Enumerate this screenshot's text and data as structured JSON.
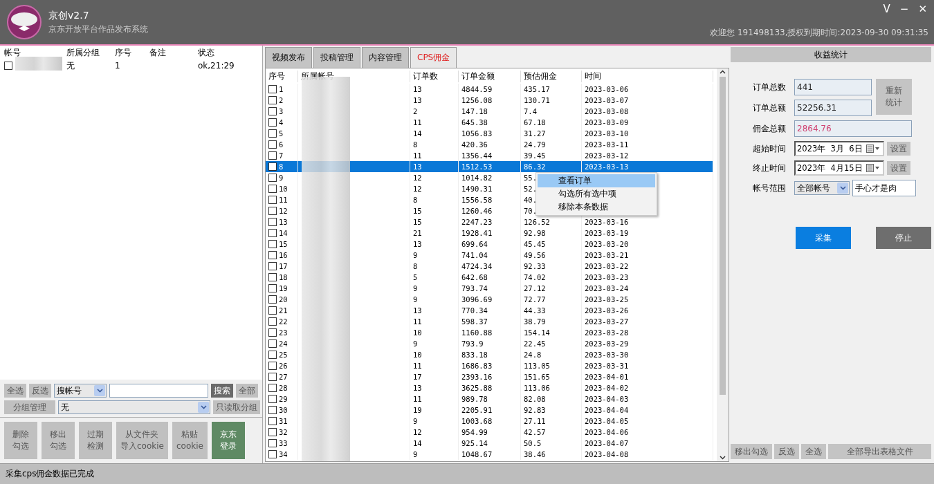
{
  "window": {
    "title": "京创v2.7",
    "subtitle": "京东开放平台作品发布系统",
    "controls": [
      "V",
      "−",
      "✕"
    ],
    "welcome": "欢迎您 191498133,授权到期时间:2023-09-30 09:31:35"
  },
  "accounts": {
    "columns": [
      "帐号",
      "所属分组",
      "序号",
      "备注",
      "状态"
    ],
    "rows": [
      {
        "checked": false,
        "group": "无",
        "index": "1",
        "status": "ok,21:29"
      }
    ]
  },
  "account_tools": {
    "select_all": "全选",
    "invert": "反选",
    "search_mode": "搜帐号",
    "search_button": "搜索",
    "all_button": "全部",
    "group_manage": "分组管理",
    "group_value": "无",
    "readonly_group": "只读取分组",
    "actions": [
      {
        "lines": [
          "删除",
          "勾选"
        ],
        "kind": "plain"
      },
      {
        "lines": [
          "移出",
          "勾选"
        ],
        "kind": "plain"
      },
      {
        "lines": [
          "过期",
          "检测"
        ],
        "kind": "plain"
      },
      {
        "lines": [
          "从文件夹",
          "导入cookie"
        ],
        "kind": "plain"
      },
      {
        "lines": [
          "粘贴",
          "cookie"
        ],
        "kind": "plain"
      },
      {
        "lines": [
          "京东",
          "登录"
        ],
        "kind": "primary"
      }
    ]
  },
  "tabs": [
    {
      "label": "视频发布",
      "selected": false
    },
    {
      "label": "投稿管理",
      "selected": false
    },
    {
      "label": "内容管理",
      "selected": false
    },
    {
      "label": "CPS佣金",
      "selected": true
    }
  ],
  "orders": {
    "columns": [
      "序号",
      "所属帐号",
      "订单数",
      "订单金额",
      "预估佣金",
      "时间"
    ],
    "rows": [
      {
        "no": "1",
        "checked": false,
        "selected": false,
        "count": "13",
        "amount": "4844.59",
        "commission": "435.17",
        "time": "2023-03-06"
      },
      {
        "no": "2",
        "checked": false,
        "selected": false,
        "count": "13",
        "amount": "1256.08",
        "commission": "130.71",
        "time": "2023-03-07"
      },
      {
        "no": "3",
        "checked": false,
        "selected": false,
        "count": "2",
        "amount": "147.18",
        "commission": "7.4",
        "time": "2023-03-08"
      },
      {
        "no": "4",
        "checked": false,
        "selected": false,
        "count": "11",
        "amount": "645.38",
        "commission": "67.18",
        "time": "2023-03-09"
      },
      {
        "no": "5",
        "checked": false,
        "selected": false,
        "count": "14",
        "amount": "1056.83",
        "commission": "31.27",
        "time": "2023-03-10"
      },
      {
        "no": "6",
        "checked": false,
        "selected": false,
        "count": "8",
        "amount": "420.36",
        "commission": "24.79",
        "time": "2023-03-11"
      },
      {
        "no": "7",
        "checked": false,
        "selected": false,
        "count": "11",
        "amount": "1356.44",
        "commission": "39.45",
        "time": "2023-03-12"
      },
      {
        "no": "8",
        "checked": false,
        "selected": true,
        "count": "13",
        "amount": "1512.53",
        "commission": "86.32",
        "time": "2023-03-13"
      },
      {
        "no": "9",
        "checked": false,
        "selected": false,
        "count": "12",
        "amount": "1014.82",
        "commission": "55."
      },
      {
        "no": "10",
        "checked": false,
        "selected": false,
        "count": "12",
        "amount": "1490.31",
        "commission": "52."
      },
      {
        "no": "11",
        "checked": false,
        "selected": false,
        "count": "8",
        "amount": "1556.58",
        "commission": "40."
      },
      {
        "no": "12",
        "checked": false,
        "selected": false,
        "count": "15",
        "amount": "1260.46",
        "commission": "70."
      },
      {
        "no": "13",
        "checked": false,
        "selected": false,
        "count": "15",
        "amount": "2247.23",
        "commission": "126.52",
        "time": "2023-03-16"
      },
      {
        "no": "14",
        "checked": false,
        "selected": false,
        "count": "21",
        "amount": "1928.41",
        "commission": "92.98",
        "time": "2023-03-19"
      },
      {
        "no": "15",
        "checked": false,
        "selected": false,
        "count": "13",
        "amount": "699.64",
        "commission": "45.45",
        "time": "2023-03-20"
      },
      {
        "no": "16",
        "checked": false,
        "selected": false,
        "count": "9",
        "amount": "741.04",
        "commission": "49.56",
        "time": "2023-03-21"
      },
      {
        "no": "17",
        "checked": false,
        "selected": false,
        "count": "8",
        "amount": "4724.34",
        "commission": "92.33",
        "time": "2023-03-22"
      },
      {
        "no": "18",
        "checked": false,
        "selected": false,
        "count": "5",
        "amount": "642.68",
        "commission": "74.02",
        "time": "2023-03-23"
      },
      {
        "no": "19",
        "checked": false,
        "selected": false,
        "count": "9",
        "amount": "793.74",
        "commission": "27.12",
        "time": "2023-03-24"
      },
      {
        "no": "20",
        "checked": false,
        "selected": false,
        "count": "9",
        "amount": "3096.69",
        "commission": "72.77",
        "time": "2023-03-25"
      },
      {
        "no": "21",
        "checked": false,
        "selected": false,
        "count": "13",
        "amount": "770.34",
        "commission": "44.33",
        "time": "2023-03-26"
      },
      {
        "no": "22",
        "checked": false,
        "selected": false,
        "count": "11",
        "amount": "598.37",
        "commission": "38.79",
        "time": "2023-03-27"
      },
      {
        "no": "23",
        "checked": false,
        "selected": false,
        "count": "10",
        "amount": "1160.88",
        "commission": "154.14",
        "time": "2023-03-28"
      },
      {
        "no": "24",
        "checked": false,
        "selected": false,
        "count": "9",
        "amount": "793.9",
        "commission": "22.45",
        "time": "2023-03-29"
      },
      {
        "no": "25",
        "checked": false,
        "selected": false,
        "count": "10",
        "amount": "833.18",
        "commission": "24.8",
        "time": "2023-03-30"
      },
      {
        "no": "26",
        "checked": false,
        "selected": false,
        "count": "11",
        "amount": "1686.83",
        "commission": "113.05",
        "time": "2023-03-31"
      },
      {
        "no": "27",
        "checked": false,
        "selected": false,
        "count": "17",
        "amount": "2393.16",
        "commission": "151.65",
        "time": "2023-04-01"
      },
      {
        "no": "28",
        "checked": false,
        "selected": false,
        "count": "13",
        "amount": "3625.88",
        "commission": "113.06",
        "time": "2023-04-02"
      },
      {
        "no": "29",
        "checked": false,
        "selected": false,
        "count": "11",
        "amount": "989.78",
        "commission": "82.08",
        "time": "2023-04-03"
      },
      {
        "no": "30",
        "checked": false,
        "selected": false,
        "count": "19",
        "amount": "2205.91",
        "commission": "92.83",
        "time": "2023-04-04"
      },
      {
        "no": "31",
        "checked": false,
        "selected": false,
        "count": "9",
        "amount": "1003.68",
        "commission": "27.11",
        "time": "2023-04-05"
      },
      {
        "no": "32",
        "checked": false,
        "selected": false,
        "count": "12",
        "amount": "954.99",
        "commission": "42.57",
        "time": "2023-04-06"
      },
      {
        "no": "33",
        "checked": false,
        "selected": false,
        "count": "14",
        "amount": "925.14",
        "commission": "50.5",
        "time": "2023-04-07"
      },
      {
        "no": "34",
        "checked": false,
        "selected": false,
        "count": "9",
        "amount": "1048.67",
        "commission": "38.46",
        "time": "2023-04-08"
      }
    ]
  },
  "context_menu": {
    "items": [
      {
        "label": "查看订单",
        "selected": true
      },
      {
        "label": "勾选所有选中项",
        "selected": false
      },
      {
        "label": "移除本条数据",
        "selected": false
      }
    ]
  },
  "stats": {
    "title": "收益统计",
    "order_count_label": "订单总数",
    "order_count": "441",
    "order_amount_label": "订单总额",
    "order_amount": "52256.31",
    "recount": [
      "重新",
      "统计"
    ],
    "commission_label": "佣金总额",
    "commission": "2864.76",
    "start_label": "超始时间",
    "start_date": "2023年  3月  6日",
    "end_label": "终止时间",
    "end_date": "2023年  4月15日",
    "set_button": "设置",
    "set_button_2": "设置",
    "scope_label": "帐号范围",
    "scope_value": "全部帐号",
    "scope_text": "手心才是肉",
    "collect": "采集",
    "stop": "停止",
    "bottom_buttons": [
      "移出勾选",
      "反选",
      "全选",
      "全部导出表格文件"
    ]
  },
  "status_bar": "采集cps佣金数据已完成"
}
